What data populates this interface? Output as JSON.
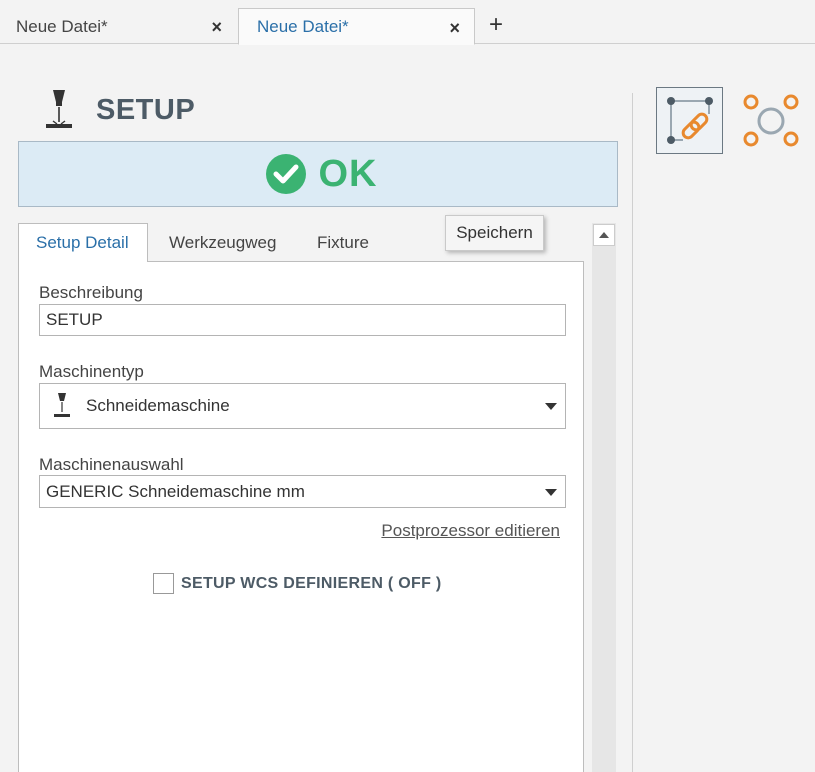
{
  "tabs": [
    {
      "label": "Neue Datei*",
      "close": "×"
    },
    {
      "label": "Neue Datei*",
      "close": "×"
    }
  ],
  "add_tab": "+",
  "header": {
    "title": "SETUP",
    "icon": "laser-cutter-icon"
  },
  "status": {
    "text": "OK",
    "icon": "checkmark-circle-icon",
    "color": "#3bb372"
  },
  "inner_tabs": [
    "Setup Detail",
    "Werkzeugweg",
    "Fixture"
  ],
  "save_label": "Speichern",
  "form": {
    "description_label": "Beschreibung",
    "description_value": "SETUP",
    "machine_type_label": "Maschinentyp",
    "machine_type_value": "Schneidemaschine",
    "machine_select_label": "Maschinenauswahl",
    "machine_select_value": "GENERIC Schneidemaschine mm",
    "postprocessor_link": "Postprozessor editieren",
    "wcs_label": "SETUP WCS DEFINIEREN ( OFF )",
    "wcs_checked": false
  },
  "right_tools": [
    {
      "icon": "link-select-icon",
      "active": true
    },
    {
      "icon": "nodes-icon",
      "active": false
    }
  ],
  "colors": {
    "accent": "#2a6fa8",
    "ok_green": "#3bb372",
    "orange": "#e8892e",
    "banner_bg": "#dcebf5"
  }
}
